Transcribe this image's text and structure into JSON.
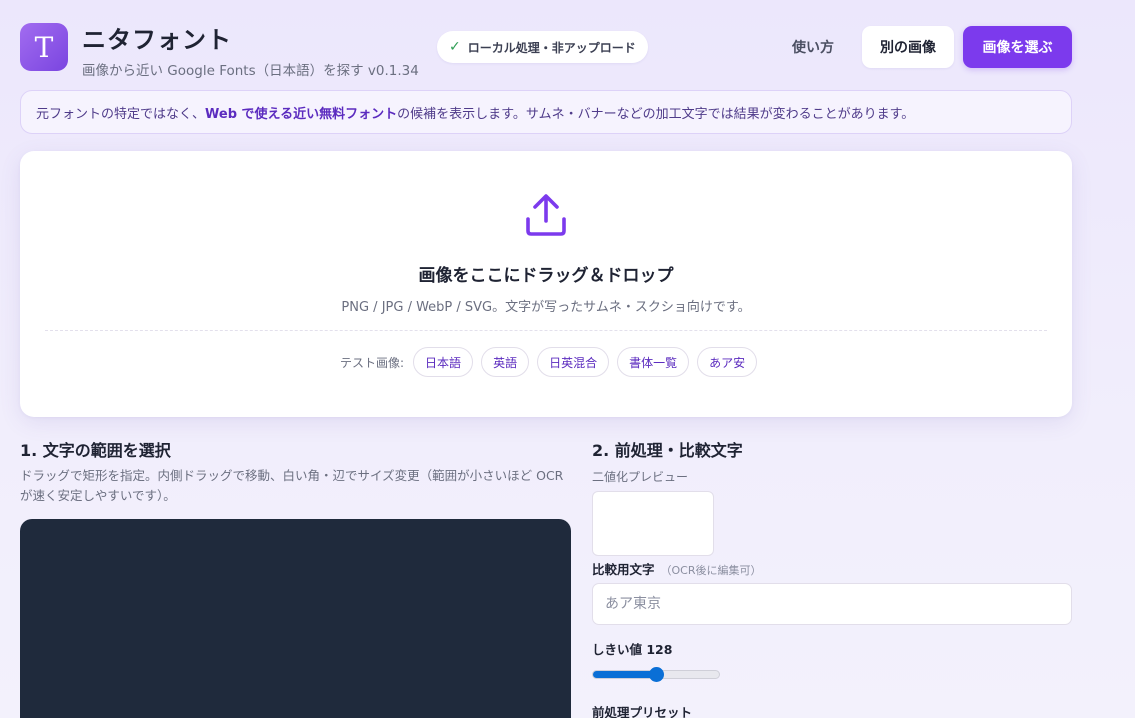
{
  "header": {
    "logo_letter": "T",
    "title": "ニタフォント",
    "subtitle": "画像から近い Google Fonts（日本語）を探す v0.1.34",
    "local_badge": "ローカル処理・非アップロード",
    "howto_label": "使い方",
    "other_image_label": "別の画像",
    "pick_image_label": "画像を選ぶ"
  },
  "notice": {
    "prefix": "元フォントの特定ではなく、",
    "highlight": "Web で使える近い無料フォント",
    "suffix": "の候補を表示します。サムネ・バナーなどの加工文字では結果が変わることがあります。"
  },
  "upload": {
    "title": "画像をここにドラッグ＆ドロップ",
    "hint": "PNG / JPG / WebP / SVG。文字が写ったサムネ・スクショ向けです。",
    "samples_label": "テスト画像:",
    "samples": [
      "日本語",
      "英語",
      "日英混合",
      "書体一覧",
      "あア安"
    ]
  },
  "section1": {
    "title": "1. 文字の範囲を選択",
    "description": "ドラッグで矩形を指定。内側ドラッグで移動、白い角・辺でサイズ変更（範囲が小さいほど OCR が速く安定しやすいです）。"
  },
  "section2": {
    "title": "2. 前処理・比較文字",
    "binarize_label": "二値化プレビュー",
    "compare_label": "比較用文字",
    "compare_note": "（OCR後に編集可）",
    "compare_placeholder": "あア東京",
    "threshold_label": "しきい値 128",
    "threshold_value": 128,
    "threshold_max": 255,
    "preset_label": "前処理プリセット"
  },
  "colors": {
    "accent": "#7c3aed",
    "check": "#2f9e55",
    "slider": "#0a6fd6",
    "canvas": "#1f2a3c"
  }
}
